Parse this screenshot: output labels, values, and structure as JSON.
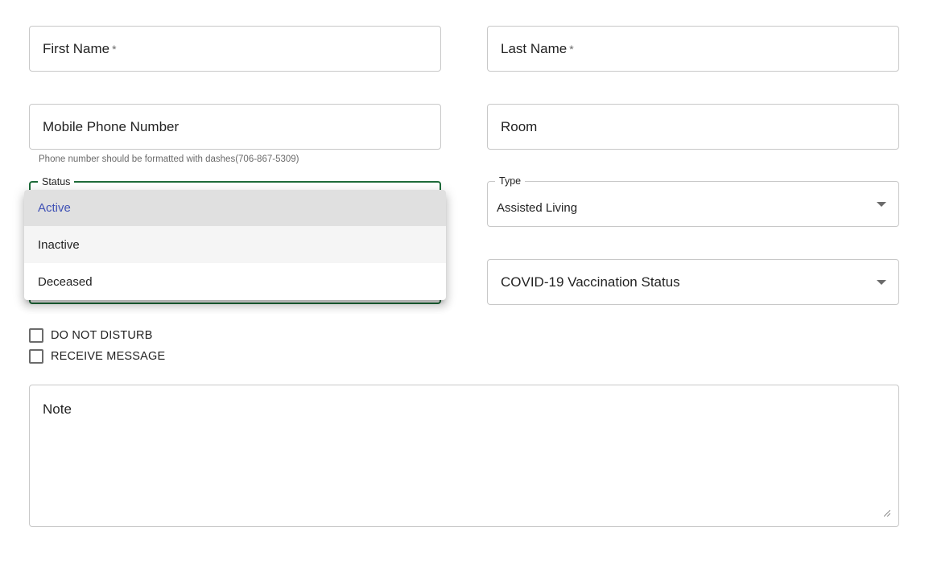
{
  "form": {
    "first_name": {
      "label": "First Name",
      "required_mark": "*"
    },
    "last_name": {
      "label": "Last Name",
      "required_mark": "*"
    },
    "mobile_phone": {
      "label": "Mobile Phone Number",
      "helper": "Phone number should be formatted with dashes(706-867-5309)"
    },
    "room": {
      "label": "Room"
    },
    "status": {
      "label": "Status",
      "options": [
        "Active",
        "Inactive",
        "Deceased"
      ],
      "selected": "Active",
      "hovered": "Inactive"
    },
    "type": {
      "label": "Type",
      "value": "Assisted Living"
    },
    "covid": {
      "label": "COVID-19 Vaccination Status"
    },
    "checkboxes": [
      {
        "label": "DO NOT DISTURB",
        "checked": false
      },
      {
        "label": "RECEIVE MESSAGE",
        "checked": false
      }
    ],
    "note": {
      "label": "Note"
    }
  },
  "colors": {
    "focus_border": "#1e6b3a",
    "selected_text": "#3f51b5",
    "selected_bg": "#e0e0e0",
    "hover_bg": "#f5f5f5"
  },
  "icons": {
    "caret": "arrow-drop-down-icon",
    "resize": "resize-handle-icon"
  }
}
